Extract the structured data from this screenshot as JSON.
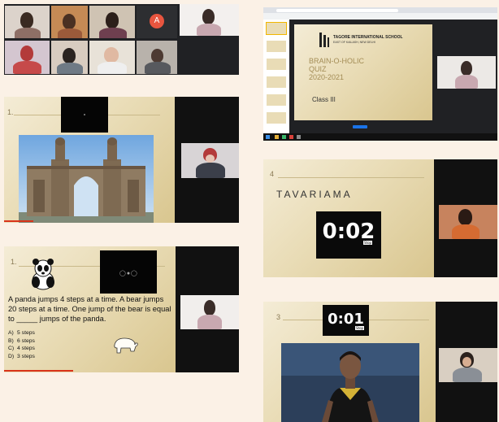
{
  "shot1": {
    "participant_initial": "A"
  },
  "shot2": {
    "school_name": "TAGORE INTERNATIONAL SCHOOL",
    "school_sub": "EAST OF KAILASH, NEW DELHI",
    "quiz_title_1": "BRAIN-O-HOLIC",
    "quiz_title_2": "QUIZ",
    "quiz_year": "2020-2021",
    "class_label": "Class III"
  },
  "shot3": {
    "slide_number": "1."
  },
  "shot4": {
    "slide_number": "4",
    "title": "TAVARIAMA",
    "timer": "0:02",
    "timer_label": "Stop"
  },
  "shot5": {
    "slide_number": "1.",
    "question": "A panda jumps 4 steps at a time. A bear jumps 20 steps at a time. One jump of the bear is equal to _____ jumps of the panda.",
    "options": [
      {
        "key": "A)",
        "text": "5 steps"
      },
      {
        "key": "B)",
        "text": "6 steps"
      },
      {
        "key": "C)",
        "text": "4 steps"
      },
      {
        "key": "D)",
        "text": "3 steps"
      }
    ]
  },
  "shot6": {
    "slide_number": "3",
    "timer": "0:01",
    "timer_label": "Stop"
  },
  "colors": {
    "background": "#fbf1e6",
    "slide_gold": "#e9dcb6",
    "timer_bg": "#0a0a0a",
    "accent_red": "#d9341a"
  }
}
